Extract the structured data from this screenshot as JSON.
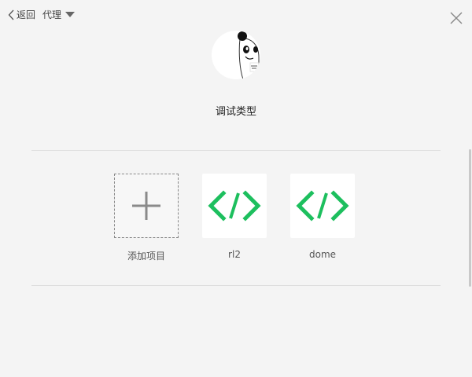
{
  "header": {
    "back_label": "返回",
    "proxy_label": "代理"
  },
  "profile": {
    "title": "调试类型"
  },
  "projects": [
    {
      "label": "添加项目",
      "icon": "plus-icon"
    },
    {
      "label": "rl2",
      "icon": "code-icon"
    },
    {
      "label": "dome",
      "icon": "code-icon"
    }
  ],
  "colors": {
    "accent": "#1dbf5e",
    "background": "#f4f4f4"
  }
}
